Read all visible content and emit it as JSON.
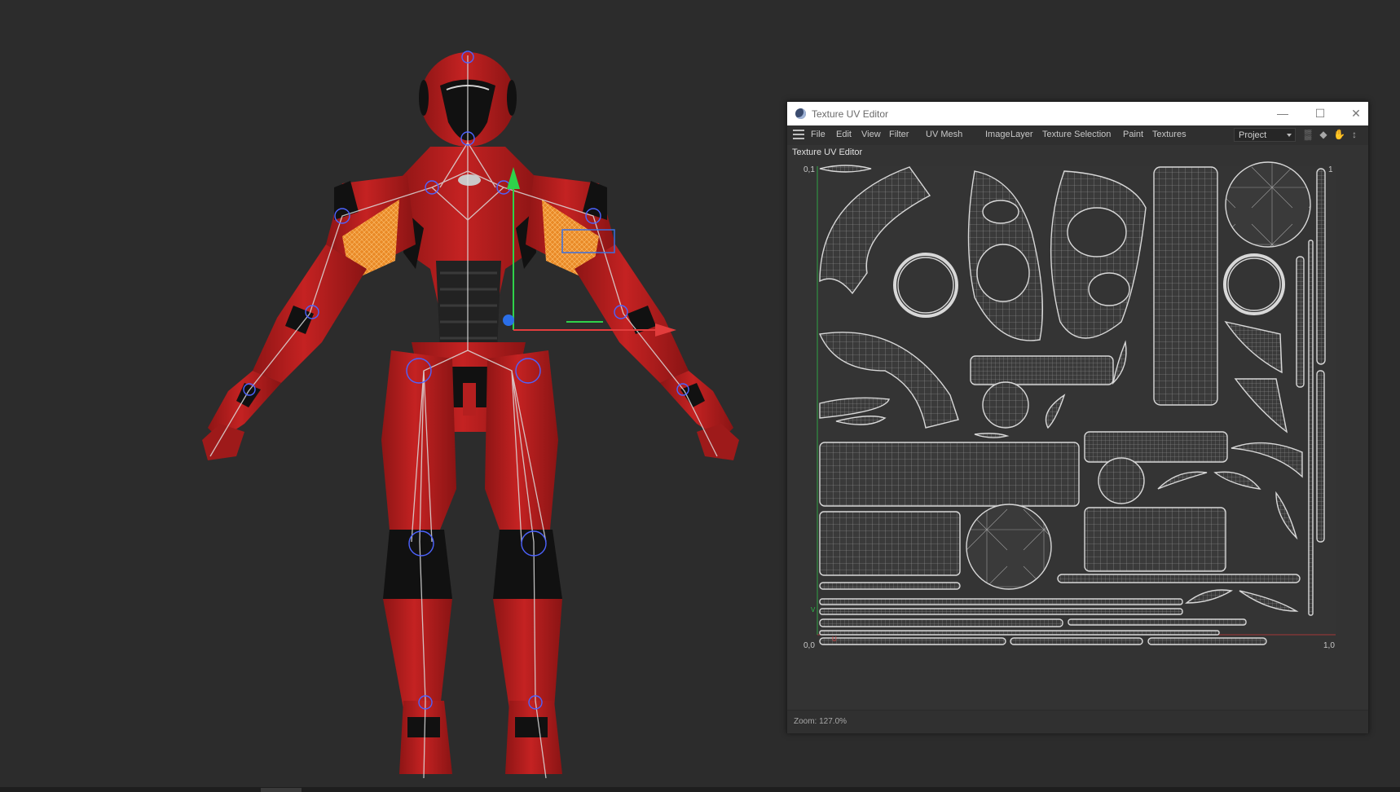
{
  "uv_editor": {
    "title": "Texture UV Editor",
    "menu": [
      "File",
      "Edit",
      "View",
      "Filter",
      "UV Mesh",
      "Image",
      "Layer",
      "Texture Selection",
      "Paint",
      "Textures"
    ],
    "mode_select": "Project",
    "panel_label": "Texture UV Editor",
    "axis": {
      "top_left": "0,1",
      "top_right": "1",
      "bottom_left": "0,0",
      "bottom_right": "1,0",
      "v_axis": "V",
      "u_axis": "U"
    },
    "status": "Zoom: 127.0%"
  },
  "colors": {
    "viewport_bg": "#2c2c2c",
    "robot_red": "#b51f1f",
    "robot_dark": "#111111",
    "selection_orange": "#f2922b",
    "uv_wire": "#cfcfcf"
  },
  "icons": {
    "app": "cinema4d-app-icon",
    "minimize": "minimize-icon",
    "maximize": "maximize-icon",
    "close": "close-icon",
    "hamburger": "hamburger-menu-icon",
    "histogram": "histogram-icon",
    "lock": "lock-icon",
    "hand": "hand-icon",
    "pin": "pin-icon"
  }
}
